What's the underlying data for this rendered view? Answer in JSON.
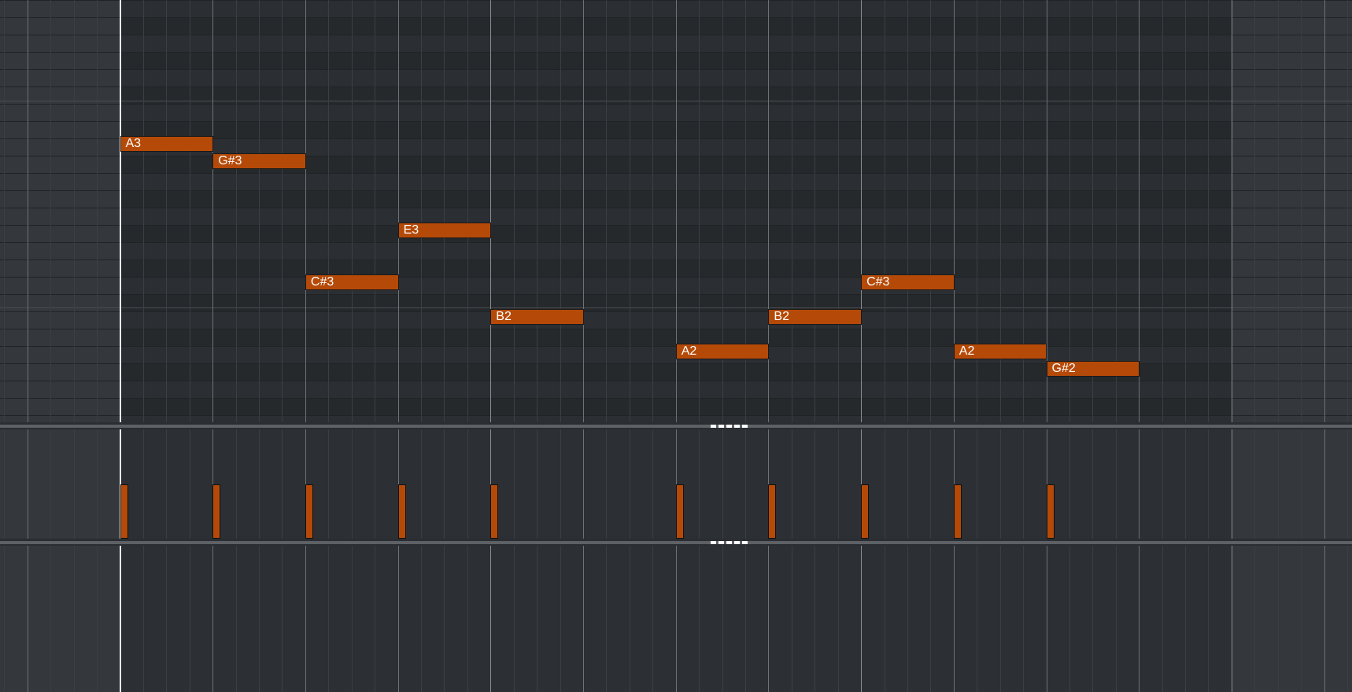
{
  "colors": {
    "background": "#2c2f33",
    "out_of_range_background": "#34373b",
    "note_fill": "#b54a08",
    "note_border": "#1a1a1a",
    "note_text": "#ffffff",
    "playhead": "#e8e8e8",
    "splitter": "#5d6166",
    "beat_line": "#6e7276",
    "bar_line": "#8a8e92"
  },
  "piano_roll": {
    "notes": [
      {
        "pitch": "A3",
        "start_step": 0
      },
      {
        "pitch": "G#3",
        "start_step": 1
      },
      {
        "pitch": "C#3",
        "start_step": 2
      },
      {
        "pitch": "E3",
        "start_step": 3
      },
      {
        "pitch": "B2",
        "start_step": 4
      },
      {
        "pitch": "A2",
        "start_step": 6
      },
      {
        "pitch": "B2",
        "start_step": 7
      },
      {
        "pitch": "C#3",
        "start_step": 8
      },
      {
        "pitch": "A2",
        "start_step": 9
      },
      {
        "pitch": "G#2",
        "start_step": 10
      }
    ],
    "note_length_steps": 1
  },
  "velocity_lane": {
    "bars": [
      {
        "start_step": 0
      },
      {
        "start_step": 1
      },
      {
        "start_step": 2
      },
      {
        "start_step": 3
      },
      {
        "start_step": 4
      },
      {
        "start_step": 6
      },
      {
        "start_step": 7
      },
      {
        "start_step": 8
      },
      {
        "start_step": 9
      },
      {
        "start_step": 10
      }
    ]
  }
}
